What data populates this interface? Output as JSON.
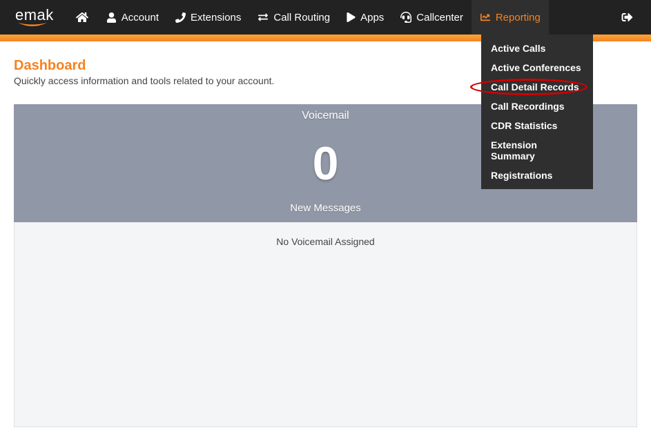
{
  "logo": {
    "text": "emak"
  },
  "nav": {
    "items": [
      {
        "label": ""
      },
      {
        "label": "Account"
      },
      {
        "label": "Extensions"
      },
      {
        "label": "Call Routing"
      },
      {
        "label": "Apps"
      },
      {
        "label": "Callcenter"
      },
      {
        "label": "Reporting"
      }
    ]
  },
  "dropdown": {
    "items": [
      {
        "label": "Active Calls"
      },
      {
        "label": "Active Conferences"
      },
      {
        "label": "Call Detail Records"
      },
      {
        "label": "Call Recordings"
      },
      {
        "label": "CDR Statistics"
      },
      {
        "label": "Extension Summary"
      },
      {
        "label": "Registrations"
      }
    ]
  },
  "page": {
    "title": "Dashboard",
    "subtitle": "Quickly access information and tools related to your account."
  },
  "voicemail": {
    "header": "Voicemail",
    "count": "0",
    "sub": "New Messages",
    "empty": "No Voicemail Assigned"
  }
}
